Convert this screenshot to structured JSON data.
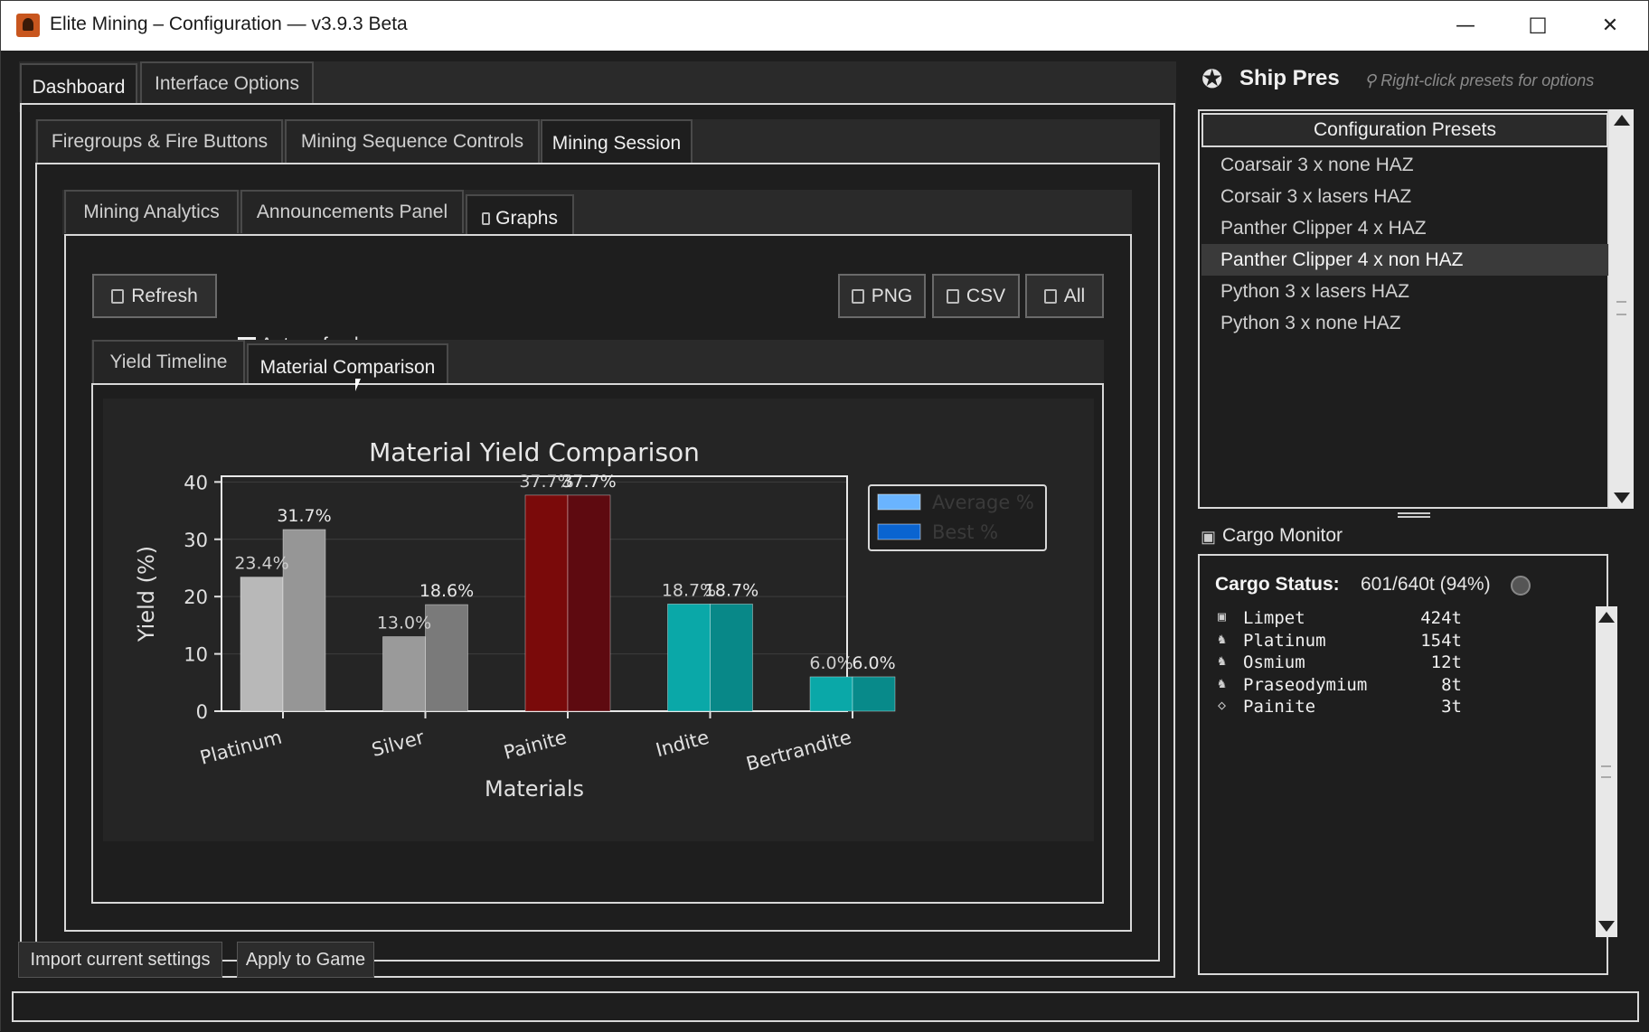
{
  "window": {
    "title": "Elite Mining – Configuration — v3.9.3 Beta",
    "minimize": "—",
    "maximize": "☐",
    "close": "✕"
  },
  "tabs_top": [
    "Dashboard",
    "Interface Options"
  ],
  "tabs_second": [
    "Firegroups & Fire Buttons",
    "Mining Sequence Controls",
    "Mining Session"
  ],
  "tabs_third": [
    "Mining Analytics",
    "Announcements Panel",
    "Graphs"
  ],
  "tabs_graph": [
    "Yield Timeline",
    "Material Comparison"
  ],
  "toolbar": {
    "refresh": "Refresh",
    "autorefresh": "Auto-refresh",
    "autorefresh_mark": "✕",
    "png": "PNG",
    "csv": "CSV",
    "all": "All"
  },
  "presets": {
    "title": "Ship Pres",
    "hint": "Right-click presets for options",
    "header": "Configuration Presets",
    "items": [
      "Coarsair 3 x none HAZ",
      "Corsair 3 x lasers HAZ",
      "Panther Clipper 4 x HAZ",
      "Panther Clipper 4 x non HAZ",
      "Python 3 x lasers HAZ",
      "Python 3 x none HAZ"
    ]
  },
  "cargo": {
    "title": "Cargo Monitor",
    "status_label": "Cargo Status:",
    "status_value": "601/640t (94%)",
    "rows": [
      {
        "name": "Limpet",
        "amount": "424t"
      },
      {
        "name": "Platinum",
        "amount": "154t"
      },
      {
        "name": "Osmium",
        "amount": "12t"
      },
      {
        "name": "Praseodymium",
        "amount": "8t"
      },
      {
        "name": "Painite",
        "amount": "3t"
      }
    ]
  },
  "bottom": {
    "import": "Import current settings",
    "apply": "Apply to Game"
  },
  "colors": {
    "avg_platinum": "#b8b8b8",
    "best_platinum": "#969696",
    "avg_silver": "#9a9a9a",
    "best_silver": "#7a7a7a",
    "avg_painite": "#7a0a0a",
    "best_painite": "#5e0a10",
    "avg_indite": "#0aa8a8",
    "best_indite": "#088888",
    "avg_bertrandite": "#0aa8a8",
    "best_bertrandite": "#088a8a",
    "legend_avg": "#6ab4ff",
    "legend_best": "#0a64d0"
  },
  "chart_data": {
    "type": "bar",
    "title": "Material Yield Comparison",
    "xlabel": "Materials",
    "ylabel": "Yield (%)",
    "categories": [
      "Platinum",
      "Silver",
      "Painite",
      "Indite",
      "Bertrandite"
    ],
    "series": [
      {
        "name": "Average %",
        "values": [
          23.4,
          13.0,
          37.7,
          18.7,
          6.0
        ]
      },
      {
        "name": "Best %",
        "values": [
          31.7,
          18.6,
          37.7,
          18.7,
          6.0
        ]
      }
    ],
    "labels_avg": [
      "23.4%",
      "13.0%",
      "37.7%",
      "18.7%",
      "6.0%"
    ],
    "labels_best": [
      "31.7%",
      "18.6%",
      "37.7%",
      "18.7%",
      "6.0%"
    ],
    "yticks": [
      0,
      10,
      20,
      30,
      40
    ],
    "ylim": [
      0,
      41
    ],
    "grid": true,
    "legend": "outside-right"
  }
}
